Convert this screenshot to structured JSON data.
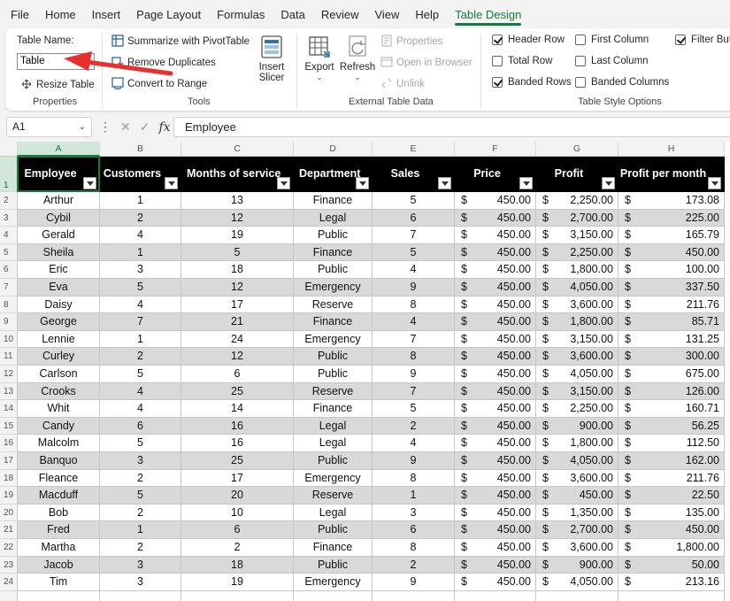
{
  "menu": {
    "tabs": [
      "File",
      "Home",
      "Insert",
      "Page Layout",
      "Formulas",
      "Data",
      "Review",
      "View",
      "Help",
      "Table Design"
    ],
    "active_tab": "Table Design"
  },
  "ribbon": {
    "properties": {
      "table_name_label": "Table Name:",
      "table_name_value": "Table",
      "resize_table": "Resize Table",
      "group_label": "Properties"
    },
    "tools": {
      "summarize_pivot": "Summarize with PivotTable",
      "remove_duplicates": "Remove Duplicates",
      "convert_to_range": "Convert to Range",
      "insert_slicer_line1": "Insert",
      "insert_slicer_line2": "Slicer",
      "group_label": "Tools"
    },
    "external": {
      "export": "Export",
      "refresh": "Refresh",
      "properties": "Properties",
      "open_in_browser": "Open in Browser",
      "unlink": "Unlink",
      "group_label": "External Table Data"
    },
    "style_options": {
      "header_row": "Header Row",
      "header_row_checked": true,
      "total_row": "Total Row",
      "total_row_checked": false,
      "banded_rows": "Banded Rows",
      "banded_rows_checked": true,
      "first_column": "First Column",
      "first_column_checked": false,
      "last_column": "Last Column",
      "last_column_checked": false,
      "banded_columns": "Banded Columns",
      "banded_columns_checked": false,
      "filter_button": "Filter Butt",
      "filter_button_checked": true,
      "group_label": "Table Style Options"
    }
  },
  "formula_bar": {
    "name_box": "A1",
    "formula": "Employee"
  },
  "sheet": {
    "column_letters": [
      "A",
      "B",
      "C",
      "D",
      "E",
      "F",
      "G",
      "H"
    ],
    "headers": [
      "Employee",
      "Customers",
      "Months of service",
      "Department",
      "Sales",
      "Price",
      "Profit",
      "Profit per month"
    ],
    "currency_symbol": "$",
    "rows": [
      [
        "Arthur",
        "1",
        "13",
        "Finance",
        "5",
        "450.00",
        "2,250.00",
        "173.08"
      ],
      [
        "Cybil",
        "2",
        "12",
        "Legal",
        "6",
        "450.00",
        "2,700.00",
        "225.00"
      ],
      [
        "Gerald",
        "4",
        "19",
        "Public",
        "7",
        "450.00",
        "3,150.00",
        "165.79"
      ],
      [
        "Sheila",
        "1",
        "5",
        "Finance",
        "5",
        "450.00",
        "2,250.00",
        "450.00"
      ],
      [
        "Eric",
        "3",
        "18",
        "Public",
        "4",
        "450.00",
        "1,800.00",
        "100.00"
      ],
      [
        "Eva",
        "5",
        "12",
        "Emergency",
        "9",
        "450.00",
        "4,050.00",
        "337.50"
      ],
      [
        "Daisy",
        "4",
        "17",
        "Reserve",
        "8",
        "450.00",
        "3,600.00",
        "211.76"
      ],
      [
        "George",
        "7",
        "21",
        "Finance",
        "4",
        "450.00",
        "1,800.00",
        "85.71"
      ],
      [
        "Lennie",
        "1",
        "24",
        "Emergency",
        "7",
        "450.00",
        "3,150.00",
        "131.25"
      ],
      [
        "Curley",
        "2",
        "12",
        "Public",
        "8",
        "450.00",
        "3,600.00",
        "300.00"
      ],
      [
        "Carlson",
        "5",
        "6",
        "Public",
        "9",
        "450.00",
        "4,050.00",
        "675.00"
      ],
      [
        "Crooks",
        "4",
        "25",
        "Reserve",
        "7",
        "450.00",
        "3,150.00",
        "126.00"
      ],
      [
        "Whit",
        "4",
        "14",
        "Finance",
        "5",
        "450.00",
        "2,250.00",
        "160.71"
      ],
      [
        "Candy",
        "6",
        "16",
        "Legal",
        "2",
        "450.00",
        "900.00",
        "56.25"
      ],
      [
        "Malcolm",
        "5",
        "16",
        "Legal",
        "4",
        "450.00",
        "1,800.00",
        "112.50"
      ],
      [
        "Banquo",
        "3",
        "25",
        "Public",
        "9",
        "450.00",
        "4,050.00",
        "162.00"
      ],
      [
        "Fleance",
        "2",
        "17",
        "Emergency",
        "8",
        "450.00",
        "3,600.00",
        "211.76"
      ],
      [
        "Macduff",
        "5",
        "20",
        "Reserve",
        "1",
        "450.00",
        "450.00",
        "22.50"
      ],
      [
        "Bob",
        "2",
        "10",
        "Legal",
        "3",
        "450.00",
        "1,350.00",
        "135.00"
      ],
      [
        "Fred",
        "1",
        "6",
        "Public",
        "6",
        "450.00",
        "2,700.00",
        "450.00"
      ],
      [
        "Martha",
        "2",
        "2",
        "Finance",
        "8",
        "450.00",
        "3,600.00",
        "1,800.00"
      ],
      [
        "Jacob",
        "3",
        "18",
        "Public",
        "2",
        "450.00",
        "900.00",
        "50.00"
      ],
      [
        "Tim",
        "3",
        "19",
        "Emergency",
        "9",
        "450.00",
        "4,050.00",
        "213.16"
      ]
    ]
  },
  "colors": {
    "accent": "#107c41",
    "header_fill": "#000000",
    "band_fill": "#d9d9d9",
    "annotation_arrow": "#e8312f"
  }
}
